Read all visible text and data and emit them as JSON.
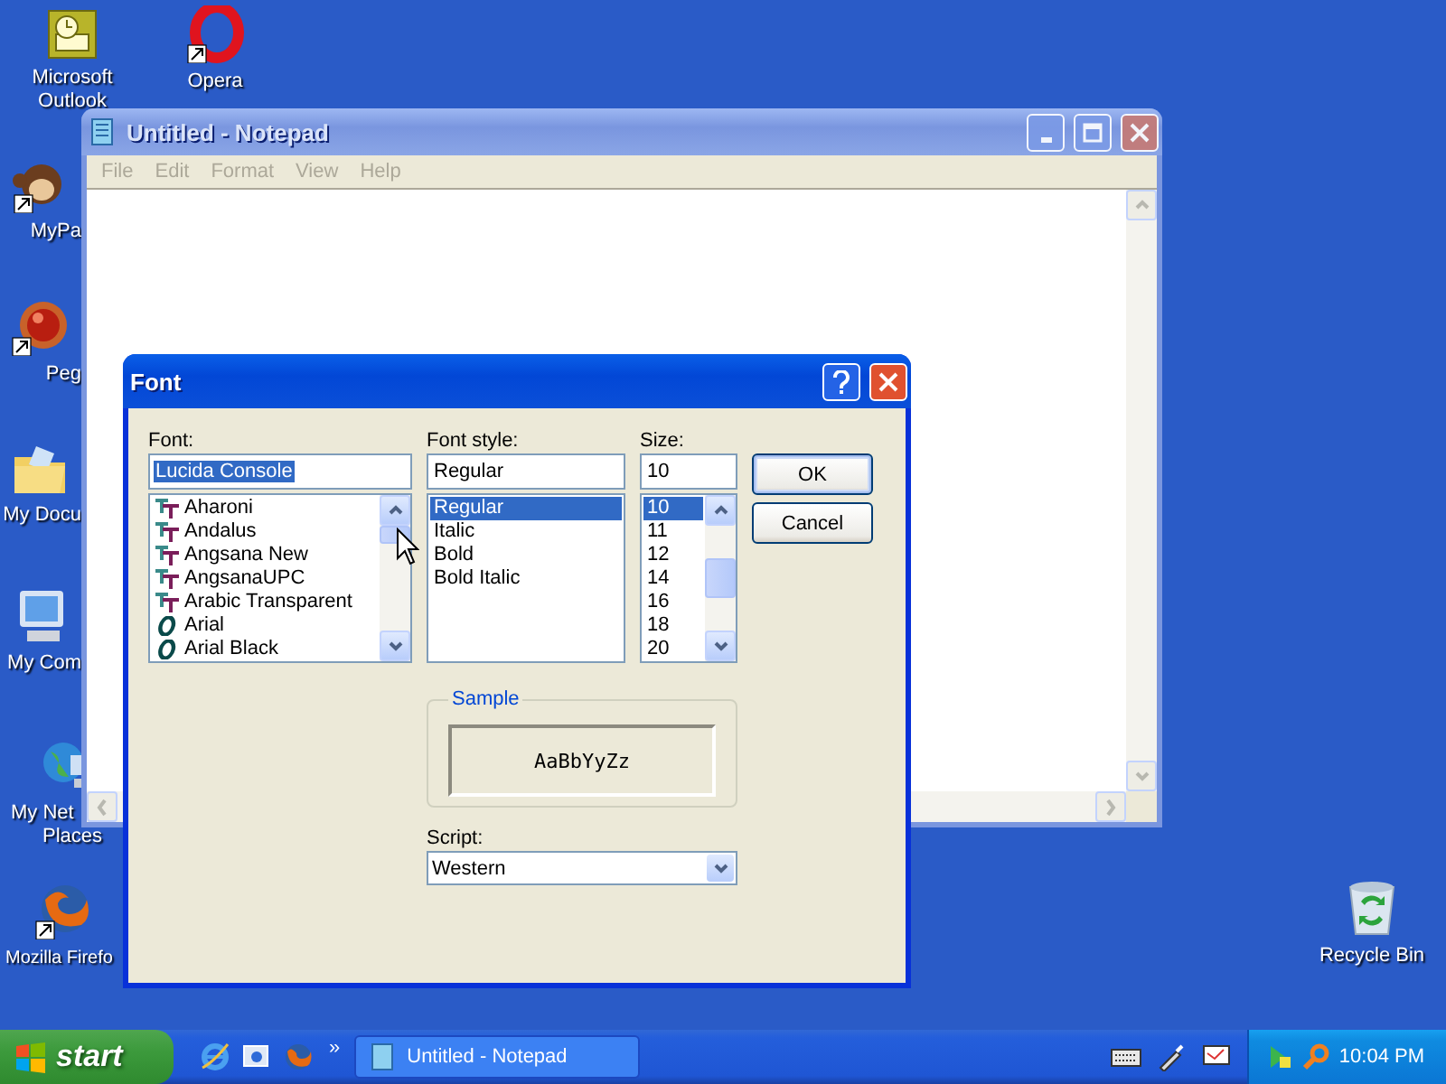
{
  "desktop_icons": [
    {
      "kind": "outlook",
      "lines": [
        "Microsoft",
        "Outlook"
      ]
    },
    {
      "kind": "opera",
      "lines": [
        "Opera"
      ]
    },
    {
      "kind": "monkey",
      "lines": [
        "MyPa"
      ]
    },
    {
      "kind": "ball",
      "lines": [
        "Peg"
      ]
    },
    {
      "kind": "folder",
      "lines": [
        "My Docu"
      ]
    },
    {
      "kind": "computer",
      "lines": [
        "My Com"
      ]
    },
    {
      "kind": "network",
      "lines": [
        "My Net",
        "Places"
      ]
    },
    {
      "kind": "firefox",
      "lines": [
        "Mozilla Firefo"
      ]
    },
    {
      "kind": "recycle",
      "lines": [
        "Recycle Bin"
      ]
    }
  ],
  "notepad": {
    "title": "Untitled - Notepad",
    "active": false,
    "menu": [
      "File",
      "Edit",
      "Format",
      "View",
      "Help"
    ]
  },
  "font_dialog": {
    "title": "Font",
    "active": true,
    "font": {
      "label": "Font:",
      "value": "Lucida Console",
      "items": [
        {
          "name": "Aharoni",
          "kind": "truetype",
          "selected": false
        },
        {
          "name": "Andalus",
          "kind": "truetype",
          "selected": false
        },
        {
          "name": "Angsana New",
          "kind": "truetype",
          "selected": false
        },
        {
          "name": "AngsanaUPC",
          "kind": "truetype",
          "selected": false
        },
        {
          "name": "Arabic Transparent",
          "kind": "truetype",
          "selected": false
        },
        {
          "name": "Arial",
          "kind": "opentype",
          "selected": false
        },
        {
          "name": "Arial Black",
          "kind": "opentype",
          "selected": false
        }
      ]
    },
    "style": {
      "label": "Font style:",
      "value": "Regular",
      "items": [
        {
          "name": "Regular",
          "selected": true
        },
        {
          "name": "Italic",
          "selected": false
        },
        {
          "name": "Bold",
          "selected": false
        },
        {
          "name": "Bold Italic",
          "selected": false
        }
      ]
    },
    "size": {
      "label": "Size:",
      "value": "10",
      "items": [
        {
          "name": "10",
          "selected": true
        },
        {
          "name": "11",
          "selected": false
        },
        {
          "name": "12",
          "selected": false
        },
        {
          "name": "14",
          "selected": false
        },
        {
          "name": "16",
          "selected": false
        },
        {
          "name": "18",
          "selected": false
        },
        {
          "name": "20",
          "selected": false
        }
      ]
    },
    "buttons": [
      "OK",
      "Cancel"
    ],
    "sample": {
      "legend": "Sample",
      "text": "AaBbYyZz"
    },
    "script": {
      "label": "Script:",
      "value": "Western"
    }
  },
  "taskbar": {
    "start": "start",
    "chevron": "»",
    "tasks": [
      {
        "title": "Untitled - Notepad",
        "selected": false
      }
    ],
    "clock": "10:04 PM"
  }
}
